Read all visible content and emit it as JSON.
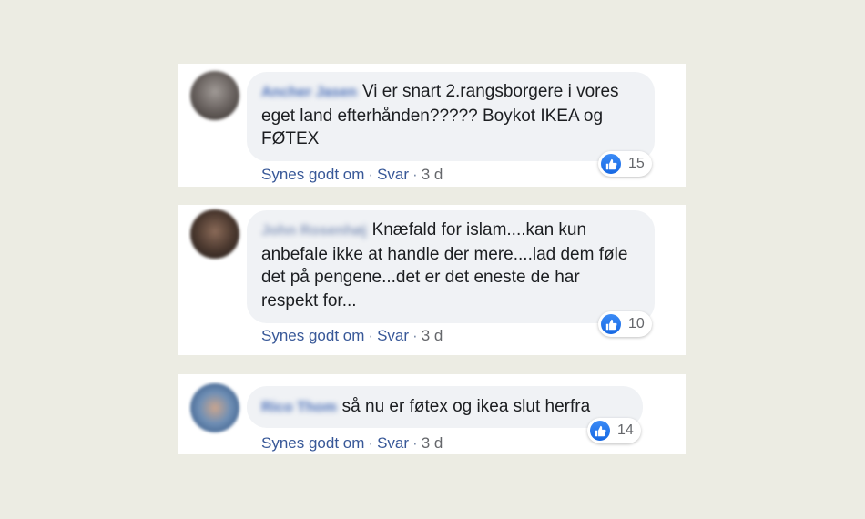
{
  "comments": [
    {
      "author": "Ancher Jasen",
      "text": "Vi er snart 2.rangsborgere i vores eget land efterhånden????? Boykot IKEA og FØTEX",
      "reaction_count": "15",
      "like_label": "Synes godt om",
      "reply_label": "Svar",
      "time": "3 d"
    },
    {
      "author": "John Rosenhøj",
      "text": "Knæfald for islam....kan kun anbefale ikke at handle der mere....lad dem føle det på pengene...det er det eneste de har respekt for...",
      "reaction_count": "10",
      "like_label": "Synes godt om",
      "reply_label": "Svar",
      "time": "3 d"
    },
    {
      "author": "Rico Thom",
      "text": "så nu er føtex og ikea slut herfra",
      "reaction_count": "14",
      "like_label": "Synes godt om",
      "reply_label": "Svar",
      "time": "3 d"
    }
  ],
  "separator": "·",
  "colors": {
    "background": "#ecece3",
    "bubble": "#f0f2f5",
    "link": "#385898",
    "like_blue": "#1877f2"
  },
  "icons": {
    "reaction": "thumbs-up-icon",
    "avatar": "blurred-profile-photo"
  }
}
